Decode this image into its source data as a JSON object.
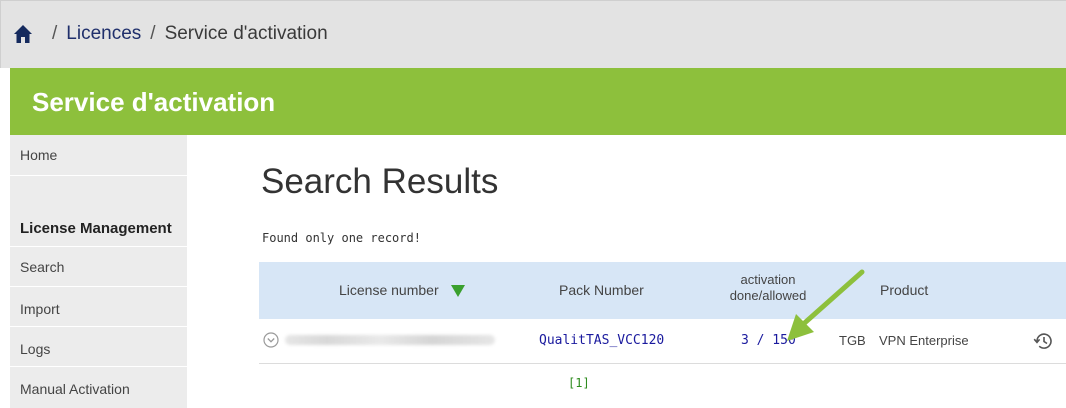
{
  "breadcrumb": {
    "separator": "/",
    "items": [
      "Licences",
      "Service d'activation"
    ],
    "home_icon": "home-icon"
  },
  "header": {
    "title": "Service d'activation",
    "color": "#8dc03c"
  },
  "sidebar": {
    "items": [
      {
        "label": "Home",
        "type": "link"
      },
      {
        "label": "License Management",
        "type": "heading"
      },
      {
        "label": "Search",
        "type": "link"
      },
      {
        "label": "Import",
        "type": "link"
      },
      {
        "label": "Logs",
        "type": "link"
      },
      {
        "label": "Manual Activation",
        "type": "link"
      }
    ]
  },
  "main": {
    "title": "Search Results",
    "message": "Found only one record!",
    "table": {
      "columns": {
        "license_number": "License number",
        "pack_number": "Pack Number",
        "activation_line1": "activation",
        "activation_line2": "done/allowed",
        "product": "Product"
      },
      "sort_indicator": "triangle-down-icon",
      "rows": [
        {
          "pack_number": "QualitTAS_VCC120",
          "activation": "3 / 150",
          "prefix": "TGB",
          "product": "VPN Enterprise"
        }
      ]
    },
    "pager": "[1]"
  },
  "annotation": {
    "type": "arrow",
    "color": "#8dc03c"
  }
}
